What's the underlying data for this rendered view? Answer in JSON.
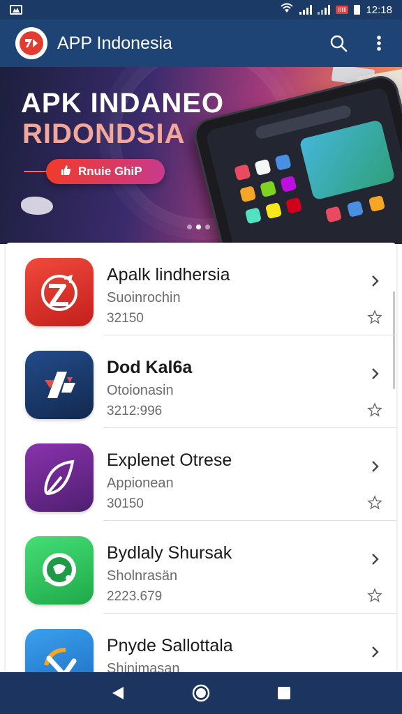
{
  "status_bar": {
    "time": "12:18",
    "badge": "IIIIl",
    "icons": [
      "notification-icon",
      "wifi-icon",
      "signal-icon",
      "signal-icon",
      "battery-icon"
    ]
  },
  "app_bar": {
    "title": "APP Indonesia",
    "actions": [
      "search-icon",
      "more-vert-icon"
    ]
  },
  "banner": {
    "title_line1": "APK INDANEO",
    "title_line2": "RIDONDSIA",
    "cta_label": "Rnuie GhiP",
    "dots": 3,
    "active_dot": 1
  },
  "apps": [
    {
      "name": "Apalk lindhersia",
      "subtitle": "Suoinrochin",
      "meta": "32150",
      "icon": "app-icon-red",
      "colors": [
        "#e8362b",
        "#c8201e"
      ]
    },
    {
      "name": "Dod Kal6a",
      "subtitle": "Otoionasin",
      "meta": "3212:996",
      "icon": "app-icon-navy",
      "colors": [
        "#1d3f78",
        "#12294f"
      ]
    },
    {
      "name": "Explenet Otrese",
      "subtitle": "Appionean",
      "meta": "30150",
      "icon": "app-icon-purple",
      "colors": [
        "#7a2a99",
        "#4e1f70"
      ]
    },
    {
      "name": "Bydlaly Shursak",
      "subtitle": "Sholnrasän",
      "meta": "2223.679",
      "icon": "app-icon-green",
      "colors": [
        "#3ad46a",
        "#1fa94a"
      ]
    },
    {
      "name": "Pnyde Sallottala",
      "subtitle": "Shinimasan",
      "meta": "",
      "icon": "app-icon-blue",
      "colors": [
        "#2f8fe0",
        "#1d6cc0"
      ]
    }
  ],
  "nav_bar": {
    "buttons": [
      "back-icon",
      "home-icon",
      "recents-icon"
    ]
  }
}
